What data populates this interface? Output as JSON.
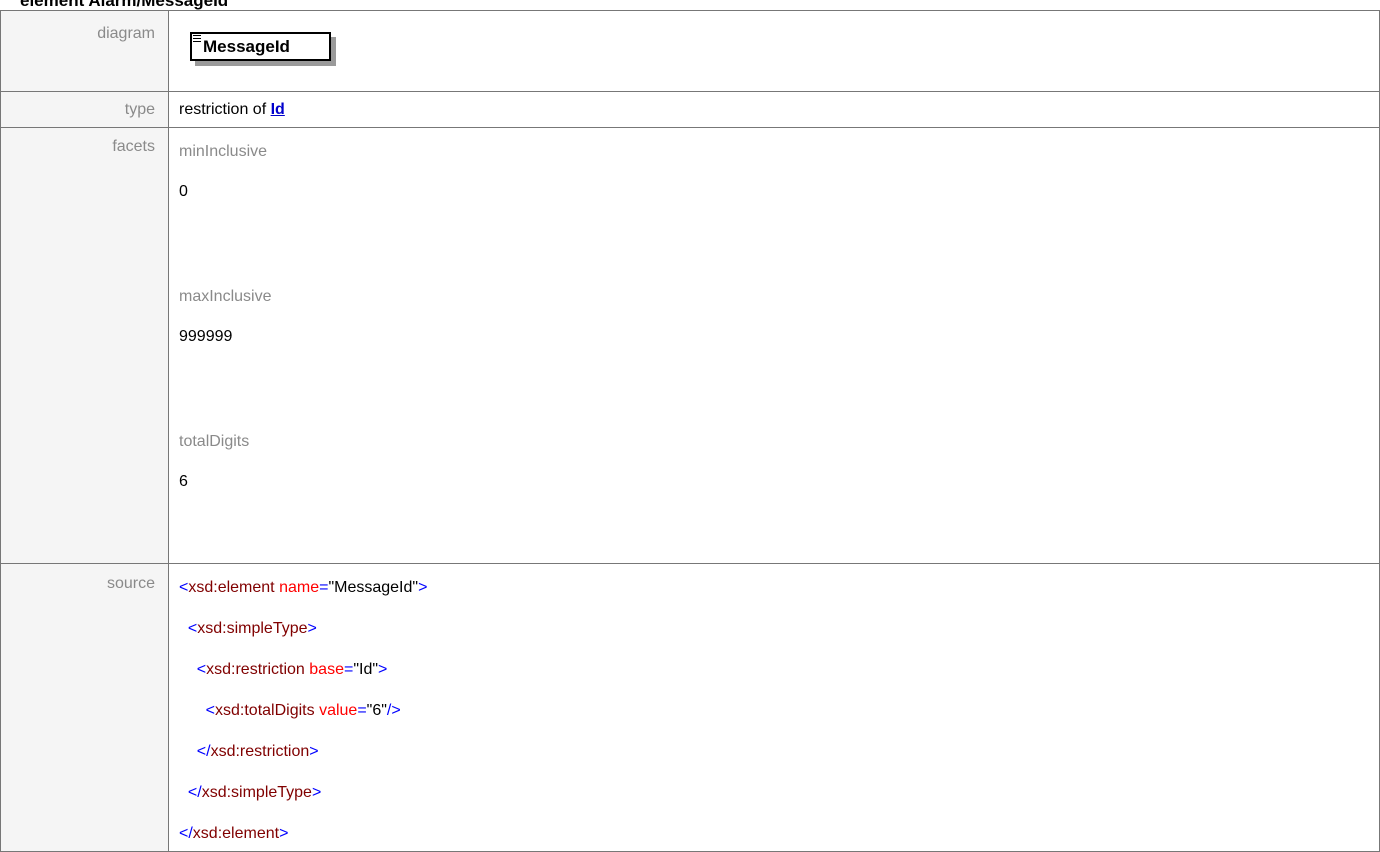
{
  "header": {
    "prefix": "element ",
    "title": "Alarm/MessageId"
  },
  "rows": {
    "diagram": {
      "label": "diagram",
      "element_name": "MessageId"
    },
    "type": {
      "label": "type",
      "text": "restriction of ",
      "link": "Id"
    },
    "facets": {
      "label": "facets",
      "items": [
        {
          "name": "minInclusive",
          "value": "0"
        },
        {
          "name": "maxInclusive",
          "value": "999999"
        },
        {
          "name": "totalDigits",
          "value": "6"
        }
      ]
    },
    "source": {
      "label": "source",
      "lines": [
        {
          "indent": "",
          "open": "<",
          "tag": "xsd:element",
          "attr": "name",
          "eq": "=",
          "value": "\"MessageId\"",
          "close": ">"
        },
        {
          "indent": "  ",
          "open": "<",
          "tag": "xsd:simpleType",
          "attr": "",
          "eq": "",
          "value": "",
          "close": ">"
        },
        {
          "indent": "    ",
          "open": "<",
          "tag": "xsd:restriction",
          "attr": "base",
          "eq": "=",
          "value": "\"Id\"",
          "close": ">"
        },
        {
          "indent": "      ",
          "open": "<",
          "tag": "xsd:totalDigits",
          "attr": "value",
          "eq": "=",
          "value": "\"6\"",
          "close": "/>"
        },
        {
          "indent": "    ",
          "open": "</",
          "tag": "xsd:restriction",
          "attr": "",
          "eq": "",
          "value": "",
          "close": ">"
        },
        {
          "indent": "  ",
          "open": "</",
          "tag": "xsd:simpleType",
          "attr": "",
          "eq": "",
          "value": "",
          "close": ">"
        },
        {
          "indent": "",
          "open": "</",
          "tag": "xsd:element",
          "attr": "",
          "eq": "",
          "value": "",
          "close": ">"
        }
      ]
    }
  },
  "colors": {
    "bracket": "#0000ff",
    "tag": "#800000",
    "attribute": "#ff0000",
    "link": "#0000cc",
    "label": "#8a8a8a",
    "label_bg": "#f5f5f5"
  }
}
